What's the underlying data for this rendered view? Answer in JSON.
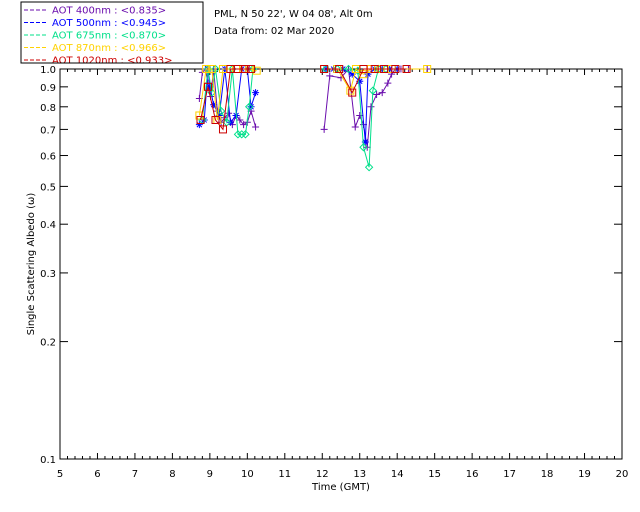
{
  "info": {
    "location": "PML, N 50 22', W 04 08', Alt 0m",
    "date": "Data from: 02 Mar 2020"
  },
  "chart_data": {
    "type": "scatter",
    "title": "",
    "xlabel": "Time (GMT)",
    "ylabel": "Single Scattering Albedo (ω)",
    "xlim": [
      5,
      20
    ],
    "ylim": [
      0.1,
      1.0
    ],
    "yscale": "log",
    "grid": false,
    "legend_position": "top-left",
    "x_ticks": [
      "5",
      "6",
      "7",
      "8",
      "9",
      "10",
      "11",
      "12",
      "13",
      "14",
      "15",
      "16",
      "17",
      "18",
      "19",
      "20"
    ],
    "y_ticks": [
      "0.1",
      "0.2",
      "0.3",
      "0.4",
      "0.5",
      "0.6",
      "0.7",
      "0.8",
      "0.9",
      "1.0"
    ],
    "series": [
      {
        "name": "AOT  400nm : <0.835>",
        "color": "#6a0dad",
        "marker": "plus",
        "x": [
          8.72,
          8.8,
          8.88,
          8.95,
          9.02,
          9.1,
          9.2,
          9.3,
          9.4,
          9.5,
          9.6,
          9.7,
          9.8,
          9.9,
          10.0,
          10.1,
          10.22,
          12.05,
          12.2,
          12.5,
          12.7,
          12.88,
          13.0,
          13.1,
          13.2,
          13.3,
          13.45,
          13.6,
          13.75,
          13.85,
          13.95,
          14.1,
          14.3,
          14.8
        ],
        "y": [
          0.84,
          0.98,
          1.0,
          0.92,
          0.85,
          1.0,
          0.78,
          0.73,
          0.75,
          0.77,
          0.72,
          0.76,
          0.74,
          0.72,
          0.73,
          0.78,
          0.71,
          0.7,
          0.96,
          0.95,
          1.0,
          0.71,
          0.76,
          0.72,
          0.63,
          0.8,
          0.86,
          0.87,
          0.92,
          0.97,
          1.0,
          1.0,
          1.0,
          1.0
        ]
      },
      {
        "name": "AOT  500nm : <0.945>",
        "color": "#0000ff",
        "marker": "star",
        "x": [
          8.72,
          8.85,
          8.95,
          9.0,
          9.1,
          9.25,
          9.4,
          9.55,
          9.7,
          9.85,
          10.0,
          10.1,
          10.22,
          12.1,
          12.3,
          12.55,
          12.8,
          13.0,
          13.15,
          13.22,
          13.4,
          13.6,
          13.8,
          14.0
        ],
        "y": [
          0.72,
          0.74,
          1.0,
          0.9,
          0.81,
          0.76,
          1.0,
          0.73,
          0.76,
          1.0,
          1.0,
          0.8,
          0.87,
          1.0,
          1.0,
          1.0,
          0.97,
          0.93,
          0.65,
          0.97,
          1.0,
          1.0,
          1.0,
          1.0
        ]
      },
      {
        "name": "AOT  675nm : <0.870>",
        "color": "#00e08a",
        "marker": "diamond",
        "x": [
          8.8,
          8.95,
          9.05,
          9.15,
          9.3,
          9.45,
          9.6,
          9.75,
          9.85,
          9.95,
          10.05,
          10.15,
          12.1,
          12.4,
          12.7,
          12.95,
          13.1,
          13.25,
          13.35,
          13.5,
          13.7
        ],
        "y": [
          0.74,
          1.0,
          0.87,
          1.0,
          0.78,
          0.73,
          1.0,
          0.68,
          0.68,
          0.68,
          0.8,
          1.0,
          1.0,
          1.0,
          1.0,
          0.99,
          0.63,
          0.56,
          0.88,
          1.0,
          1.0
        ],
        "marker_last": true
      },
      {
        "name": "AOT  870nm : <0.966>",
        "color": "#ffd200",
        "marker": "square",
        "x": [
          8.72,
          8.9,
          9.05,
          9.2,
          9.35,
          9.55,
          9.7,
          9.9,
          10.05,
          10.25,
          12.05,
          12.4,
          12.75,
          12.9,
          13.1,
          13.3,
          13.55,
          13.85,
          14.25,
          14.8
        ],
        "y": [
          0.76,
          1.0,
          1.0,
          0.74,
          1.0,
          1.0,
          1.0,
          1.0,
          1.0,
          0.99,
          1.0,
          1.0,
          0.88,
          1.0,
          0.97,
          1.0,
          1.0,
          1.0,
          1.0,
          1.0
        ]
      },
      {
        "name": "AOT 1020nm : <0.933>",
        "color": "#cc0000",
        "marker": "square",
        "x": [
          8.75,
          8.95,
          9.15,
          9.35,
          9.55,
          9.75,
          9.95,
          10.1,
          12.05,
          12.45,
          12.8,
          13.1,
          13.4,
          13.65,
          13.95,
          14.25
        ],
        "y": [
          0.74,
          0.9,
          0.74,
          0.7,
          1.0,
          1.0,
          1.0,
          1.0,
          1.0,
          1.0,
          0.87,
          1.0,
          1.0,
          1.0,
          1.0,
          1.0
        ]
      }
    ]
  }
}
